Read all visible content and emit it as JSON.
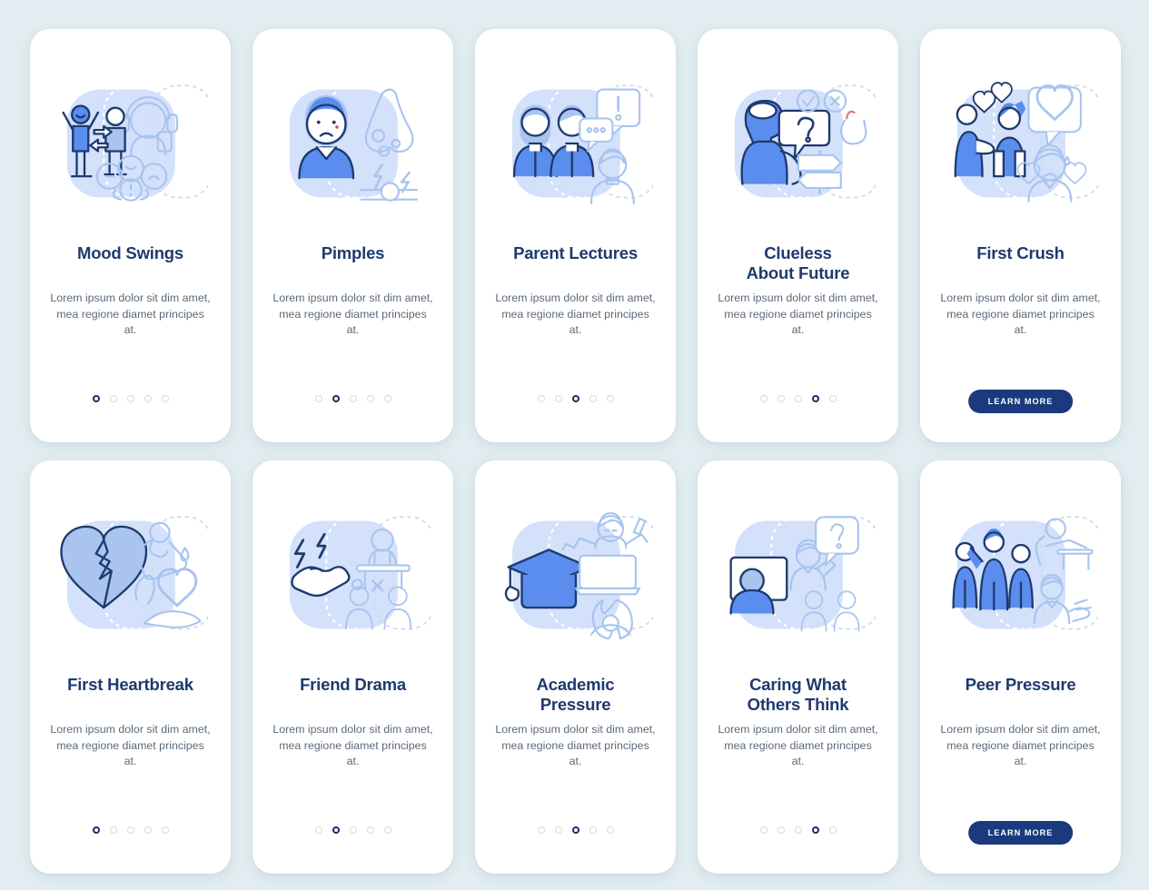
{
  "page": {
    "background_color": "#e1edf0",
    "card_background": "#ffffff",
    "title_color": "#1e3a6e",
    "body_color": "#5b6a7a",
    "accent_color": "#5b8def",
    "dot_active_color": "#17306a",
    "dot_inactive_color": "#d3dade",
    "button_color": "#1a3a7d"
  },
  "shared": {
    "body_text": "Lorem ipsum dolor sit dim amet, mea regione diamet principes at.",
    "learn_more_label": "LEARN MORE",
    "dot_count": 5
  },
  "cards": [
    {
      "title": "Mood Swings",
      "title_lines": [
        "Mood Swings"
      ],
      "body": "Lorem ipsum dolor sit dim amet, mea regione diamet principes at.",
      "footer_type": "dots",
      "active_dot": 0,
      "illustration": "mood-swings-illustration"
    },
    {
      "title": "Pimples",
      "title_lines": [
        "Pimples"
      ],
      "body": "Lorem ipsum dolor sit dim amet, mea regione diamet principes at.",
      "footer_type": "dots",
      "active_dot": 1,
      "illustration": "pimples-illustration"
    },
    {
      "title": "Parent Lectures",
      "title_lines": [
        "Parent Lectures"
      ],
      "body": "Lorem ipsum dolor sit dim amet, mea regione diamet principes at.",
      "footer_type": "dots",
      "active_dot": 2,
      "illustration": "parent-lectures-illustration"
    },
    {
      "title": "Clueless About Future",
      "title_lines": [
        "Clueless",
        "About Future"
      ],
      "body": "Lorem ipsum dolor sit dim amet, mea regione diamet principes at.",
      "footer_type": "dots",
      "active_dot": 3,
      "illustration": "clueless-about-future-illustration"
    },
    {
      "title": "First Crush",
      "title_lines": [
        "First Crush"
      ],
      "body": "Lorem ipsum dolor sit dim amet, mea regione diamet principes at.",
      "footer_type": "button",
      "active_dot": -1,
      "illustration": "first-crush-illustration"
    },
    {
      "title": "First Heartbreak",
      "title_lines": [
        "First Heartbreak"
      ],
      "body": "Lorem ipsum dolor sit dim amet, mea regione diamet principes at.",
      "footer_type": "dots",
      "active_dot": 0,
      "illustration": "first-heartbreak-illustration"
    },
    {
      "title": "Friend Drama",
      "title_lines": [
        "Friend Drama"
      ],
      "body": "Lorem ipsum dolor sit dim amet, mea regione diamet principes at.",
      "footer_type": "dots",
      "active_dot": 1,
      "illustration": "friend-drama-illustration"
    },
    {
      "title": "Academic Pressure",
      "title_lines": [
        "Academic",
        "Pressure"
      ],
      "body": "Lorem ipsum dolor sit dim amet, mea regione diamet principes at.",
      "footer_type": "dots",
      "active_dot": 2,
      "illustration": "academic-pressure-illustration"
    },
    {
      "title": "Caring What Others Think",
      "title_lines": [
        "Caring What",
        "Others Think"
      ],
      "body": "Lorem ipsum dolor sit dim amet, mea regione diamet principes at.",
      "footer_type": "dots",
      "active_dot": 3,
      "illustration": "caring-what-others-think-illustration"
    },
    {
      "title": "Peer Pressure",
      "title_lines": [
        "Peer Pressure"
      ],
      "body": "Lorem ipsum dolor sit dim amet, mea regione diamet principes at.",
      "footer_type": "button",
      "active_dot": -1,
      "illustration": "peer-pressure-illustration"
    }
  ]
}
